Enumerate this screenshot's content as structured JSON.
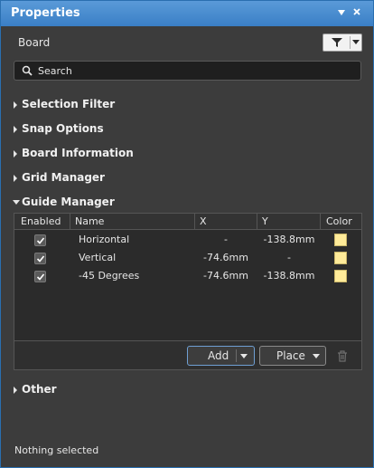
{
  "window": {
    "title": "Properties"
  },
  "icons": {
    "pin": "pin-icon",
    "close": "close-icon",
    "filter": "filter-icon",
    "search": "search-icon",
    "trash": "trash-icon"
  },
  "header": {
    "object_type": "Board"
  },
  "search": {
    "placeholder": "Search"
  },
  "sections": {
    "selection_filter": "Selection Filter",
    "snap_options": "Snap Options",
    "board_information": "Board Information",
    "grid_manager": "Grid Manager",
    "guide_manager": "Guide Manager",
    "other": "Other"
  },
  "guide_manager": {
    "columns": [
      "Enabled",
      "Name",
      "X",
      "Y",
      "Color"
    ],
    "rows": [
      {
        "enabled": true,
        "name": "Horizontal",
        "x": "-",
        "y": "-138.8mm",
        "color": "#ffeb99"
      },
      {
        "enabled": true,
        "name": "Vertical",
        "x": "-74.6mm",
        "y": "-",
        "color": "#ffeb99"
      },
      {
        "enabled": true,
        "name": "-45 Degrees",
        "x": "-74.6mm",
        "y": "-138.8mm",
        "color": "#ffeb99"
      }
    ],
    "add_label": "Add",
    "place_label": "Place"
  },
  "status": {
    "text": "Nothing selected"
  }
}
